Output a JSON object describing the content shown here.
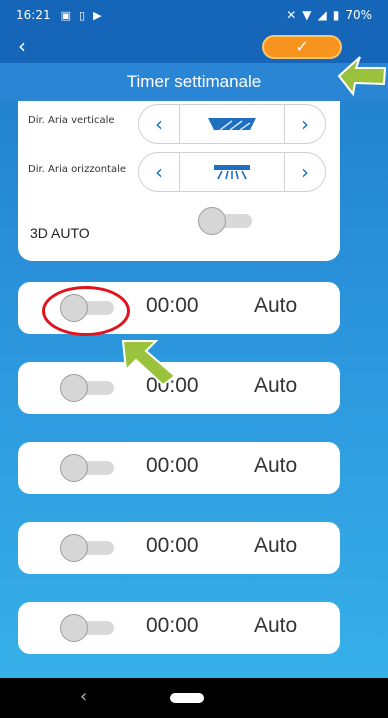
{
  "status_bar": {
    "time": "16:21",
    "battery": "70%"
  },
  "header": {
    "back_icon": "‹",
    "confirm_icon": "✓",
    "title": "Timer settimanale"
  },
  "settings": {
    "vertical_label": "Dir. Aria verticale",
    "horizontal_label": "Dir. Aria orizzontale",
    "auto3d_label": "3D AUTO",
    "left_arrow": "‹",
    "right_arrow": "›"
  },
  "timers": [
    {
      "time": "00:00",
      "mode": "Auto"
    },
    {
      "time": "00:00",
      "mode": "Auto"
    },
    {
      "time": "00:00",
      "mode": "Auto"
    },
    {
      "time": "00:00",
      "mode": "Auto"
    },
    {
      "time": "00:00",
      "mode": "Auto"
    }
  ],
  "nav": {
    "back_icon": "‹"
  },
  "colors": {
    "accent": "#f7941d",
    "header": "#1565b8",
    "annotation_arrow": "#9bc23c",
    "annotation_circle": "#e0141f"
  }
}
